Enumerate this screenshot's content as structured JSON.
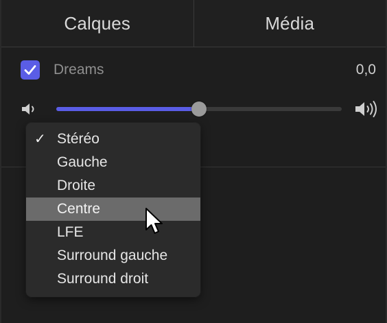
{
  "tabs": [
    {
      "label": "Calques"
    },
    {
      "label": "Média"
    }
  ],
  "track": {
    "checked": true,
    "name": "Dreams",
    "value": "0,0"
  },
  "volume": {
    "level_fraction": 0.5,
    "low_icon": "speaker-low-icon",
    "high_icon": "speaker-high-icon"
  },
  "channel_menu": {
    "selected": "Stéréo",
    "highlighted": "Centre",
    "items": [
      {
        "label": "Stéréo"
      },
      {
        "label": "Gauche"
      },
      {
        "label": "Droite"
      },
      {
        "label": "Centre"
      },
      {
        "label": "LFE"
      },
      {
        "label": "Surround gauche"
      },
      {
        "label": "Surround droit"
      }
    ]
  },
  "colors": {
    "accent": "#5a5de6",
    "background": "#1e1e1e",
    "menu_background": "#2b2b2b",
    "menu_highlight": "#6b6b6b"
  },
  "icons": {
    "checkbox": "checkmark-icon",
    "cursor": "mouse-pointer-icon"
  }
}
